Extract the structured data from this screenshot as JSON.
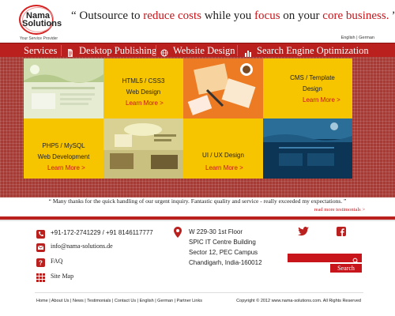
{
  "logo": {
    "line1": "Nama",
    "line2": "Solutions",
    "tagline": "Your Service Provider"
  },
  "slogan": {
    "open_quote": "“",
    "p1": " Outsource to ",
    "h1": "reduce costs",
    "p2": " while you ",
    "h2": "focus",
    "p3": " on your ",
    "h3": "core business.",
    "close_quote": "  ”"
  },
  "languages": {
    "english": "English",
    "sep": " | ",
    "german": "German"
  },
  "nav": {
    "services": "Services",
    "desktop_publishing": "Desktop Publishing",
    "website_design": "Website  Design",
    "seo": "Search Engine Optimization"
  },
  "tiles": {
    "html5": {
      "line1": "HTML5 / CSS3",
      "line2": "Web Design",
      "more": "Learn More  >"
    },
    "cms": {
      "line1": "CMS / Template",
      "line2": "Design",
      "more": "Learn More  >"
    },
    "php": {
      "line1": "PHP5 / MySQL",
      "line2": "Web Development",
      "more": "Learn More  >"
    },
    "uiux": {
      "line1": "UI / UX Design",
      "more": "Learn More  >"
    }
  },
  "testimonial": {
    "text": "“ Many thanks for the quick handling of our urgent inquiry. Fantastic quality and service - really exceeded my expectations. ”",
    "read_more": "read more testimonials >"
  },
  "contact": {
    "phone": "+91-172-2741229 / +91 8146117777",
    "email": "info@nama-solutions.de",
    "faq": "FAQ",
    "sitemap": "Site Map"
  },
  "address": {
    "line1": "W 229-30 1st Floor",
    "line2": "SPIC IT Centre Building",
    "line3": "Sector 12, PEC Campus",
    "line4": "Chandigarh, India-160012"
  },
  "search": {
    "button": "Search",
    "value": ""
  },
  "footer": {
    "links": [
      "Home",
      "About Us",
      "News",
      "Testimonials",
      "Contact Us",
      "English",
      "German",
      "Partner Links"
    ],
    "copyright": "Copyright © 2012 www.nama-solutions.com. All Rights Reserved"
  },
  "colors": {
    "brand_red": "#b9201e",
    "accent_red": "#c8151b",
    "tile_yellow": "#f7c400"
  }
}
